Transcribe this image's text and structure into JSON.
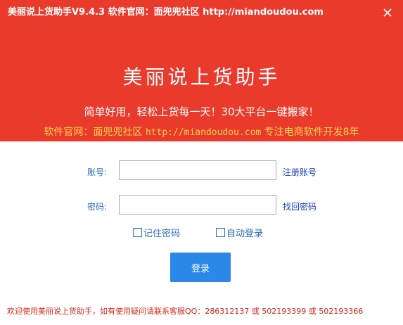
{
  "titlebar": {
    "title": "美丽说上货助手V9.4.3  软件官网：面兜兜社区 http://miandoudou.com",
    "close_icon": "close-icon"
  },
  "banner": {
    "title": "美丽说上货助手",
    "slogan": "简单好用，轻松上货每一天！30大平台一键搬家！",
    "site_prefix": "软件官网：面兜兜社区 ",
    "site_url": "http://miandoudou.com",
    "site_suffix": " 专注电商软件开发8年",
    "colors": {
      "background": "#ea3a2c",
      "accent_text": "#ffd54a"
    }
  },
  "form": {
    "account_label": "账号:",
    "account_value": "",
    "register_link": "注册账号",
    "password_label": "密码:",
    "password_value": "",
    "recover_link": "找回密码",
    "remember_label": "记住密码",
    "remember_checked": false,
    "autologin_label": "自动登录",
    "autologin_checked": false,
    "login_button": "登录"
  },
  "footer": {
    "text": "欢迎使用美丽说上货助手，如有使用疑问请联系客服QQ：286312137 或 502193399 或 502193366"
  }
}
